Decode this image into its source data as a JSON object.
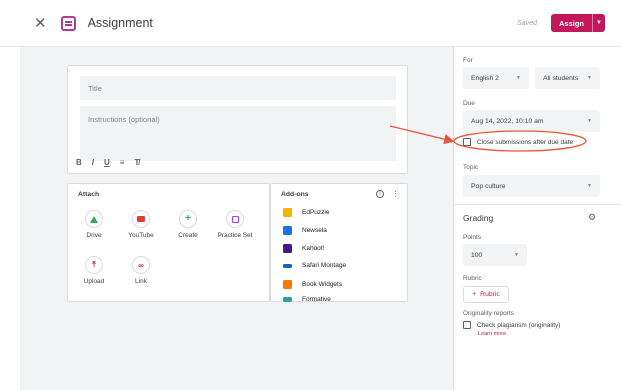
{
  "header": {
    "title": "Assignment",
    "saved_text": "Saved",
    "assign_label": "Assign"
  },
  "form": {
    "title_placeholder": "Title",
    "instructions_placeholder": "Instructions (optional)",
    "format_buttons": [
      "B",
      "I",
      "U",
      "≡",
      "T̸"
    ]
  },
  "attach": {
    "title": "Attach",
    "items": [
      {
        "label": "Drive",
        "icon": "drive-icon"
      },
      {
        "label": "YouTube",
        "icon": "youtube-icon"
      },
      {
        "label": "Create",
        "icon": "create-icon"
      },
      {
        "label": "Practice Set",
        "icon": "practice-set-icon"
      },
      {
        "label": "Upload",
        "icon": "upload-icon"
      },
      {
        "label": "Link",
        "icon": "link-icon"
      }
    ]
  },
  "addons": {
    "title": "Add-ons",
    "items": [
      {
        "label": "EdPuzzle",
        "color": "#f4b400"
      },
      {
        "label": "Newsela",
        "color": "#1a73e8"
      },
      {
        "label": "Kahoot!",
        "color": "#46178f"
      },
      {
        "label": "Safari Montage",
        "color": "#1565c0"
      },
      {
        "label": "Book Widgets",
        "color": "#f57c00"
      },
      {
        "label": "Formative",
        "color": "#26a69a"
      }
    ]
  },
  "sidebar": {
    "for_label": "For",
    "class_value": "English 2",
    "students_value": "All students",
    "due_label": "Due",
    "due_value": "Aug 14, 2022, 10:10 am",
    "close_submissions_label": "Close submissions after due date",
    "topic_label": "Topic",
    "topic_value": "Pop culture",
    "grading_label": "Grading",
    "points_label": "Points",
    "points_value": "100",
    "rubric_label": "Rubric",
    "rubric_button": "Rubric",
    "originality_label": "Originality reports",
    "check_plagiarism_label": "Check plagiarism (originality)",
    "learn_more": "Learn more"
  },
  "colors": {
    "accent": "#c2185b",
    "annotation": "#e8553a"
  }
}
